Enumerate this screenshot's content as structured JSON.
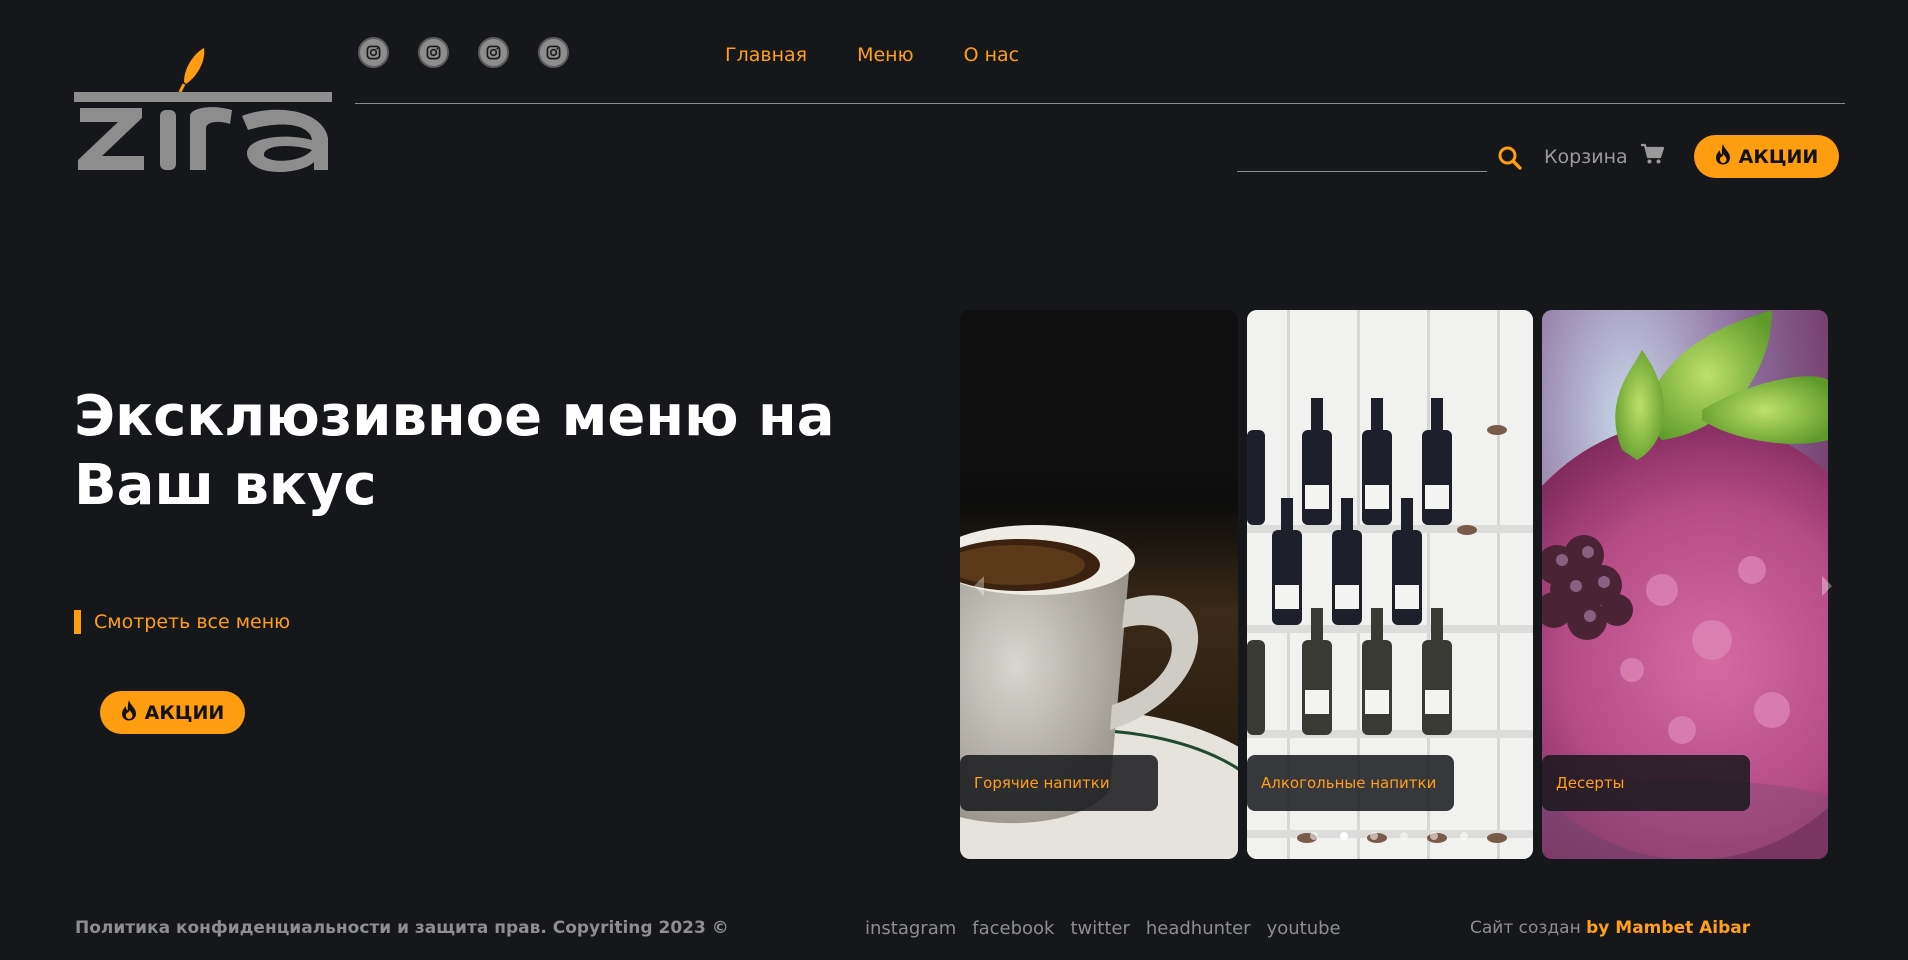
{
  "header": {
    "logo_text": "zira",
    "socials": [
      {
        "icon": "instagram-icon"
      },
      {
        "icon": "instagram-icon"
      },
      {
        "icon": "instagram-icon"
      },
      {
        "icon": "instagram-icon"
      }
    ],
    "nav": [
      {
        "label": "Главная"
      },
      {
        "label": "Меню"
      },
      {
        "label": "О нас"
      }
    ],
    "search": {
      "value": "",
      "placeholder": ""
    },
    "cart_label": "Корзина",
    "promo_label": "АКЦИИ"
  },
  "hero": {
    "title": "Эксклюзивное меню на Ваш вкус",
    "menu_link": "Смотреть все меню",
    "promo_label": "АКЦИИ"
  },
  "carousel": {
    "cards": [
      {
        "label": "Горячие напитки"
      },
      {
        "label": "Алкогольные напитки"
      },
      {
        "label": "Десерты"
      }
    ],
    "dots_count": 6,
    "active_dot": 1
  },
  "footer": {
    "copyright": "Политика конфиденциальности и защита прав. Copyriting 2023 ©",
    "links": [
      {
        "label": "instagram"
      },
      {
        "label": "facebook"
      },
      {
        "label": "twitter"
      },
      {
        "label": "headhunter"
      },
      {
        "label": "youtube"
      }
    ],
    "credit_prefix": "Сайт создан",
    "credit_author": "by Mambet Aibar"
  },
  "colors": {
    "background": "#16171b",
    "accent": "#ff9d10",
    "muted": "#8e8e8e"
  }
}
